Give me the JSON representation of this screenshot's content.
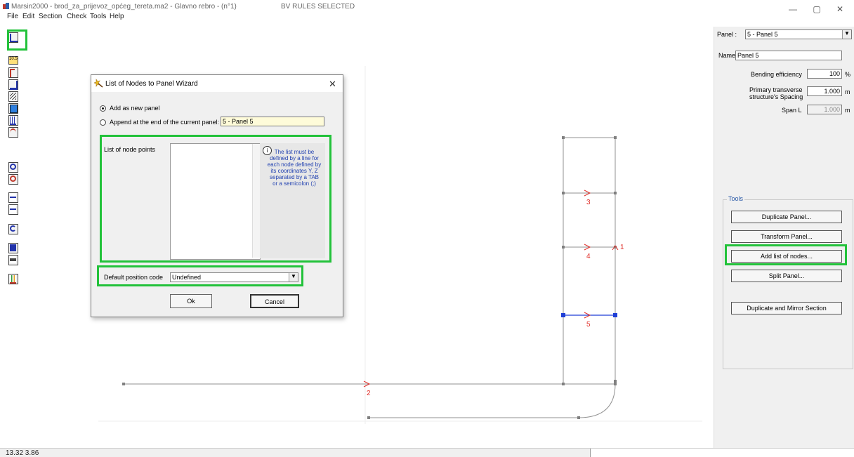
{
  "window": {
    "title": "Marsin2000 - brod_za_prijevoz_općeg_tereta.ma2 - Glavno rebro - (n°1)",
    "rules_label": "BV RULES SELECTED",
    "minimize": "—",
    "maximize": "▢",
    "close": "✕"
  },
  "menu": [
    "File",
    "Edit",
    "Section",
    "Check",
    "Tools",
    "Help"
  ],
  "toolbar_icons": [
    "panel-icon",
    "stiffener-icon",
    "thickness-icon",
    "bracket-icon",
    "girder-icon",
    "hatch-icon",
    "compartment-icon",
    "plate-icon",
    "curve-icon",
    "zoom-icon",
    "no-zoom-icon",
    "plus-icon",
    "minus-icon",
    "undo-icon",
    "save-icon",
    "print-icon",
    "chart-icon"
  ],
  "toolbar_labels": {
    "thickness": "10.5"
  },
  "panel": {
    "label": "Panel :",
    "selected": "5 - Panel 5",
    "name_label": "Name",
    "name_value": "Panel 5",
    "bending_label": "Bending efficiency",
    "bending_value": "100",
    "bending_unit": "%",
    "spacing_label_1": "Primary transverse",
    "spacing_label_2": "structure's Spacing",
    "spacing_value": "1.000",
    "spacing_unit": "m",
    "span_label": "Span L",
    "span_value": "1.000",
    "span_unit": "m"
  },
  "tools": {
    "title": "Tools",
    "buttons": [
      "Duplicate Panel...",
      "Transform Panel...",
      "Add list of nodes...",
      "Split Panel...",
      "Duplicate and Mirror Section"
    ]
  },
  "drawing": {
    "labels": [
      "3",
      "4",
      "1",
      "5",
      "2"
    ]
  },
  "dialog": {
    "title": "List of Nodes to Panel Wizard",
    "close": "✕",
    "radio_new": "Add as new panel",
    "radio_append": "Append at the end of the current panel:",
    "append_value": "5 - Panel 5",
    "list_label": "List of node points",
    "info_icon": "i",
    "info_text": "The list must be defined by a line for each node defined by its coordinates Y, Z separated by a TAB or a semicolon (;)",
    "position_label": "Default position code",
    "position_value": "Undefined",
    "ok": "Ok",
    "cancel": "Cancel"
  },
  "status": {
    "coords": "13.32 3.86"
  },
  "colors": {
    "highlight": "#22c23a",
    "marker": "#e0302a",
    "node": "#808080",
    "selected": "#1f3fd6"
  }
}
